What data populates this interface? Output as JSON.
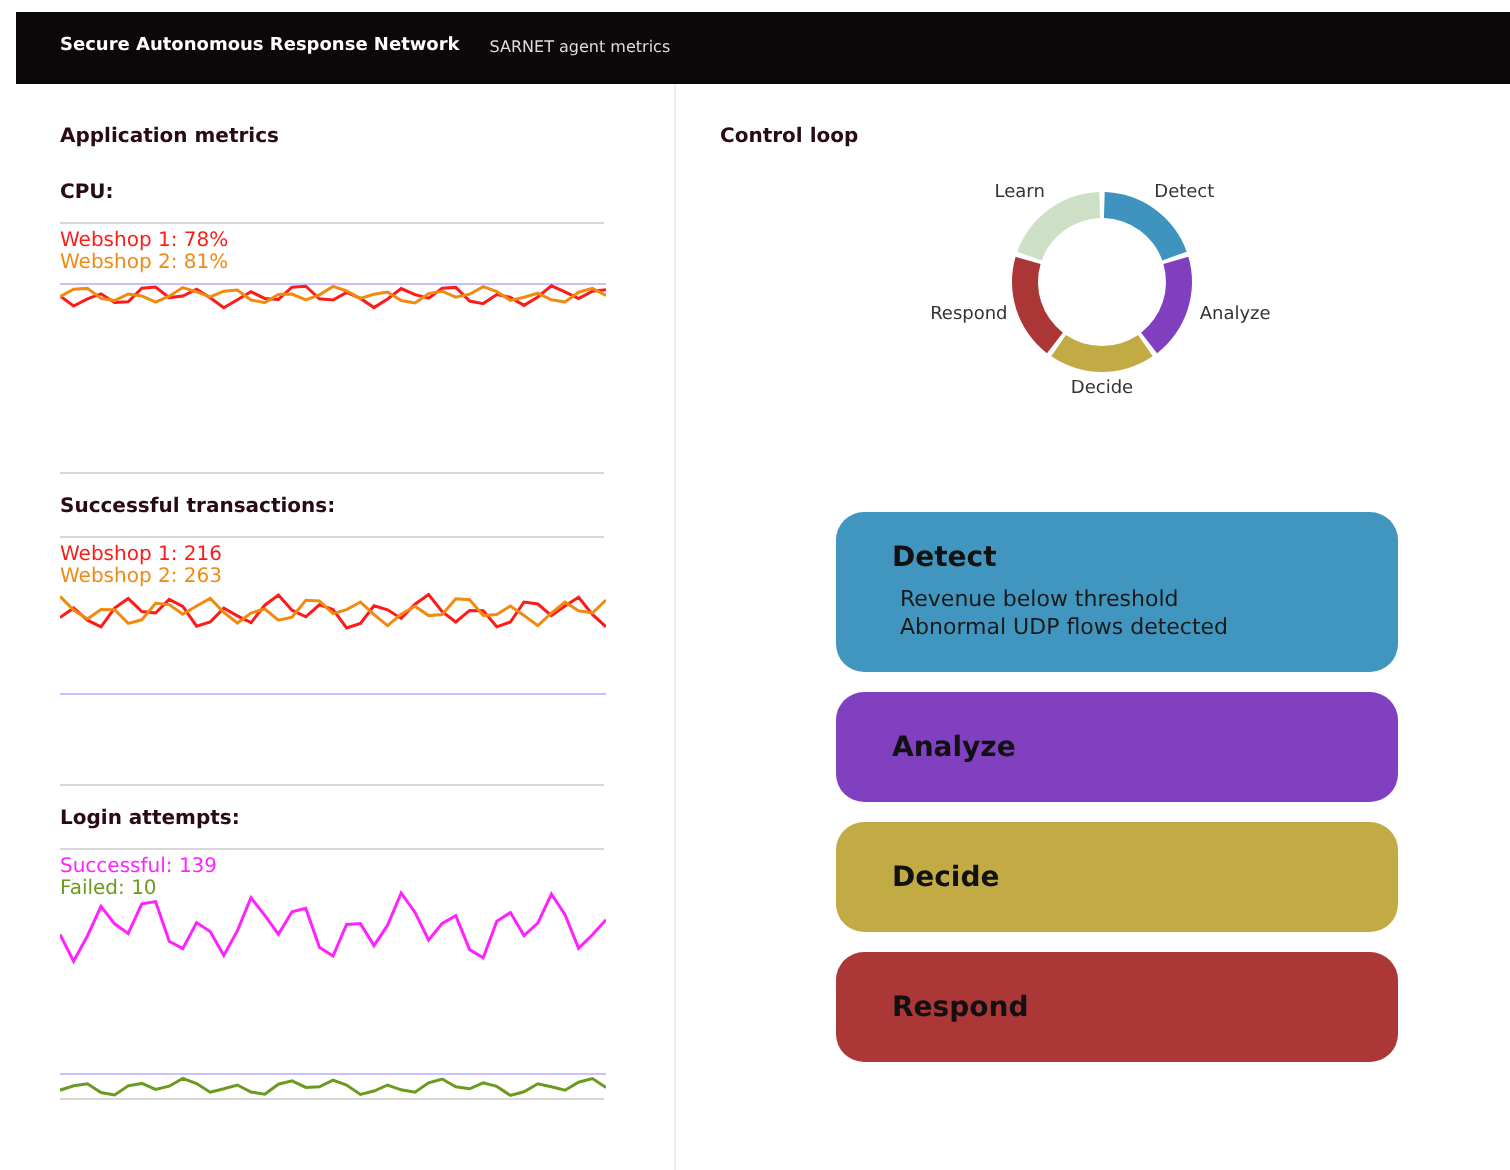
{
  "header": {
    "title": "Secure Autonomous Response Network",
    "subtitle": "SARNET agent metrics"
  },
  "application_metrics": {
    "title": "Application metrics",
    "charts": [
      {
        "title": "CPU:",
        "series": [
          {
            "label": "Webshop 1: 78%",
            "color": "#ff1a1a"
          },
          {
            "label": "Webshop 2: 81%",
            "color": "#f08a10"
          }
        ]
      },
      {
        "title": "Successful transactions:",
        "series": [
          {
            "label": "Webshop 1: 216",
            "color": "#ff1a1a"
          },
          {
            "label": "Webshop 2: 263",
            "color": "#f08a10"
          }
        ]
      },
      {
        "title": "Login attempts:",
        "series": [
          {
            "label": "Successful: 139",
            "color": "#ff22ff"
          },
          {
            "label": "Failed: 10",
            "color": "#6a9a20"
          }
        ]
      }
    ]
  },
  "control_loop": {
    "title": "Control loop",
    "cycle": [
      {
        "label": "Detect",
        "color": "#3f94bf"
      },
      {
        "label": "Analyze",
        "color": "#7f3fbf"
      },
      {
        "label": "Decide",
        "color": "#c2ab44"
      },
      {
        "label": "Respond",
        "color": "#ab3636"
      },
      {
        "label": "Learn",
        "color": "#cde0c6"
      }
    ],
    "stages": [
      {
        "title": "Detect",
        "color": "#4196bf",
        "lines": [
          "Revenue below threshold",
          "Abnormal UDP flows detected"
        ]
      },
      {
        "title": "Analyze",
        "color": "#8040c0"
      },
      {
        "title": "Decide",
        "color": "#c2ab44"
      },
      {
        "title": "Respond",
        "color": "#ab3737"
      }
    ]
  }
}
